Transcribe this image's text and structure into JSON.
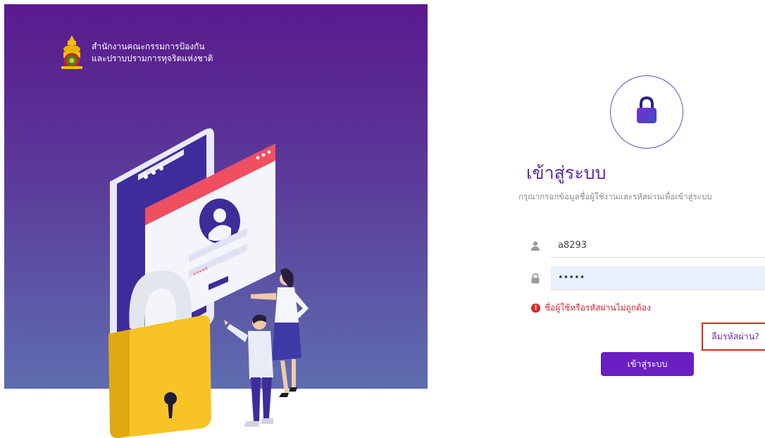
{
  "org": {
    "line1": "สำนักงานคณะกรรมการป้องกัน",
    "line2": "และปราบปรามการทุจริตแห่งชาติ",
    "logo_icon": "nacc-emblem-icon"
  },
  "illustration": {
    "password_mask": "*****"
  },
  "login": {
    "title": "เข้าสู่ระบบ",
    "subtitle": "กรุณากรอกข้อมูลชื่อผู้ใช้งานและรหัสผ่านเพื่อเข้าสู่ระบบ",
    "username_value": "a8293",
    "password_value": "•••••",
    "error_text": "ชื่อผู้ใช้หรือรหัสผ่านไม่ถูกต้อง",
    "forgot_label": "ลืมรหัสผ่าน?",
    "button_label": "เข้าสู่ระบบ",
    "icons": [
      "lock-icon",
      "user-icon",
      "padlock-icon",
      "error-icon"
    ]
  },
  "colors": {
    "primary": "#6a1fc2",
    "title": "#5b2a9e",
    "error": "#d9262c",
    "highlight_box": "#e0241f"
  }
}
